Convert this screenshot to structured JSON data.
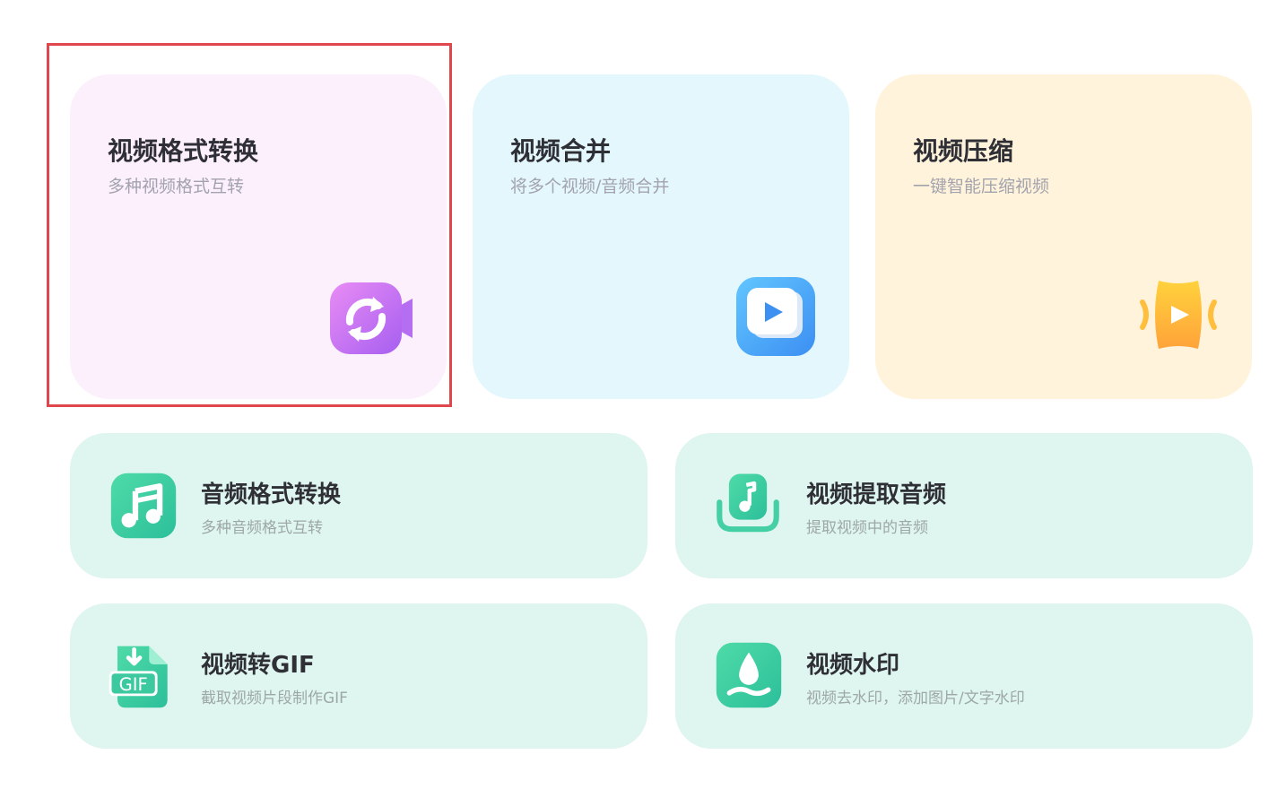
{
  "cards": {
    "video_convert": {
      "title": "视频格式转换",
      "subtitle": "多种视频格式互转",
      "icon": "video-convert-icon"
    },
    "video_merge": {
      "title": "视频合并",
      "subtitle": "将多个视频/音频合并",
      "icon": "video-merge-icon"
    },
    "video_compress": {
      "title": "视频压缩",
      "subtitle": "一键智能压缩视频",
      "icon": "video-compress-icon"
    },
    "audio_convert": {
      "title": "音频格式转换",
      "subtitle": "多种音频格式互转",
      "icon": "music-note-icon"
    },
    "extract_audio": {
      "title": "视频提取音频",
      "subtitle": "提取视频中的音频",
      "icon": "extract-audio-icon"
    },
    "video_gif": {
      "title": "视频转GIF",
      "subtitle": "截取视频片段制作GIF",
      "icon": "gif-file-icon",
      "icon_text": "GIF"
    },
    "watermark": {
      "title": "视频水印",
      "subtitle": "视频去水印，添加图片/文字水印",
      "icon": "watermark-drop-icon"
    }
  },
  "colors": {
    "highlight": "#e0474c",
    "convert_bg": "#fcf0fd",
    "merge_bg": "#e3f7fd",
    "compress_bg": "#fff3dc",
    "small_card_bg": "#dff5ef",
    "title": "#2f2f36",
    "subtitle": "#a3a3ad"
  }
}
